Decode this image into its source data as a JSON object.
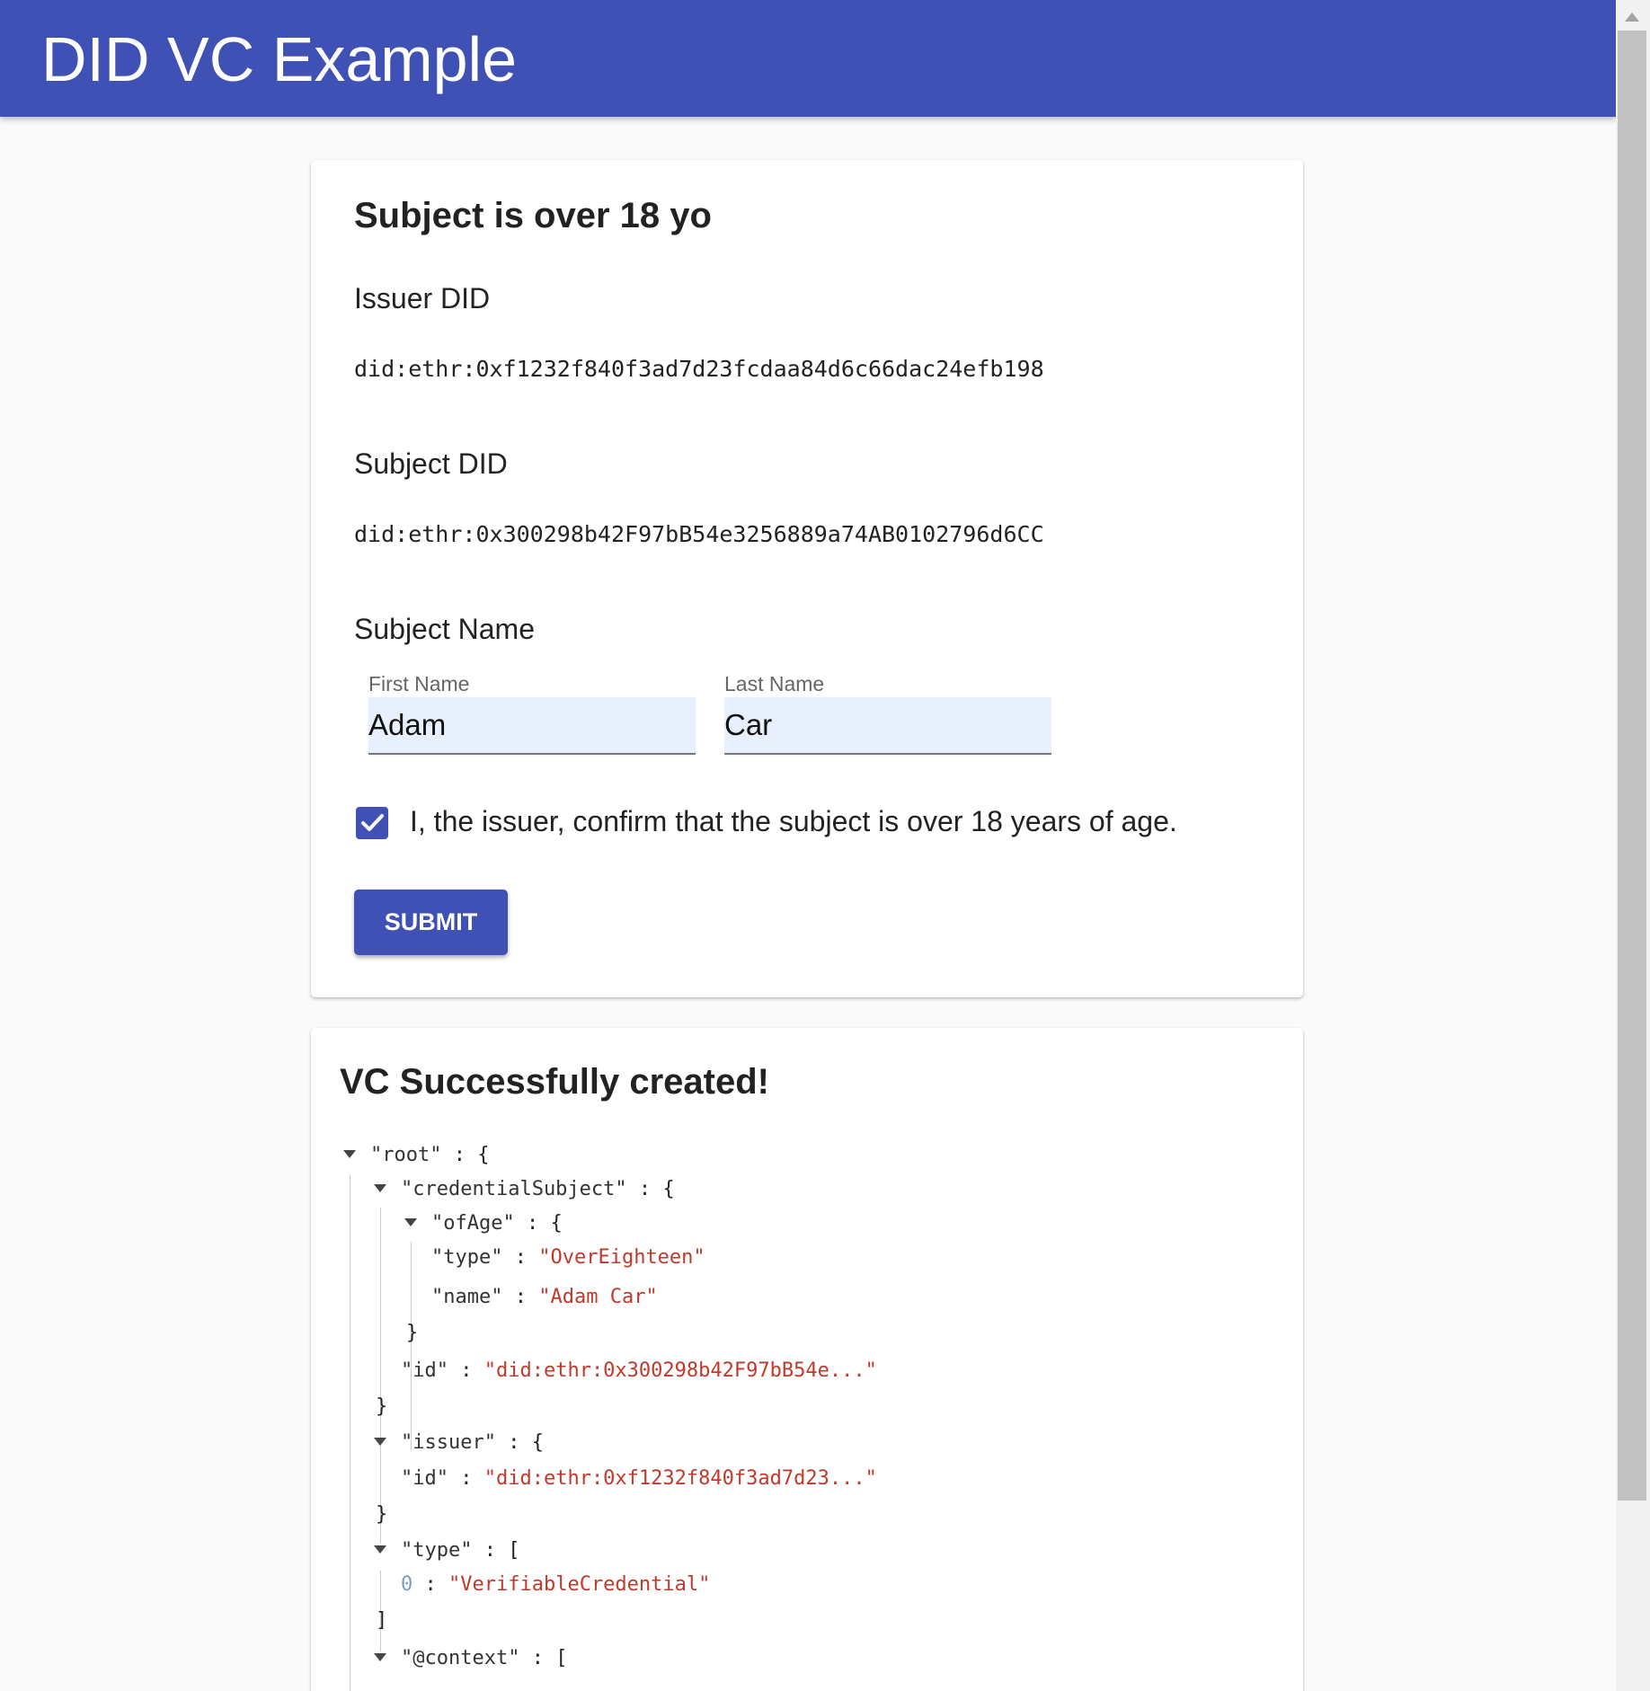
{
  "app": {
    "title": "DID VC Example"
  },
  "form": {
    "title": "Subject is over 18 yo",
    "issuer_label": "Issuer DID",
    "issuer_did": "did:ethr:0xf1232f840f3ad7d23fcdaa84d6c66dac24efb198",
    "subject_label": "Subject DID",
    "subject_did": "did:ethr:0x300298b42F97bB54e3256889a74AB0102796d6CC",
    "name_label": "Subject Name",
    "first_name": {
      "label": "First Name",
      "value": "Adam"
    },
    "last_name": {
      "label": "Last Name",
      "value": "Car"
    },
    "confirm": {
      "checked": true,
      "label": "I, the issuer, confirm that the subject is over 18 years of age."
    },
    "submit_label": "SUBMIT"
  },
  "result": {
    "title": "VC Successfully created!",
    "tree": {
      "root_key": "\"root\"",
      "credentialSubject_key": "\"credentialSubject\"",
      "ofAge_key": "\"ofAge\"",
      "type_key": "\"type\"",
      "type_value": "\"OverEighteen\"",
      "name_key": "\"name\"",
      "name_value": "\"Adam Car\"",
      "id_key": "\"id\"",
      "subject_id_value": "\"did:ethr:0x300298b42F97bB54e...\"",
      "issuer_key": "\"issuer\"",
      "issuer_id_value": "\"did:ethr:0xf1232f840f3ad7d23...\"",
      "vc_type_key": "\"type\"",
      "vc_type_index": "0",
      "vc_type_value": "\"VerifiableCredential\"",
      "context_key": "\"@context\"",
      "obj_open": ": {",
      "arr_open": ": [",
      "obj_close": "}",
      "arr_close": "]",
      "colon": ":"
    }
  },
  "icons": {
    "checkbox": "checkmark-icon",
    "tree_toggle": "caret-down-icon"
  },
  "colors": {
    "primary": "#3f51b5",
    "json_string": "#c0392b",
    "input_bg": "#e8f0fe"
  }
}
